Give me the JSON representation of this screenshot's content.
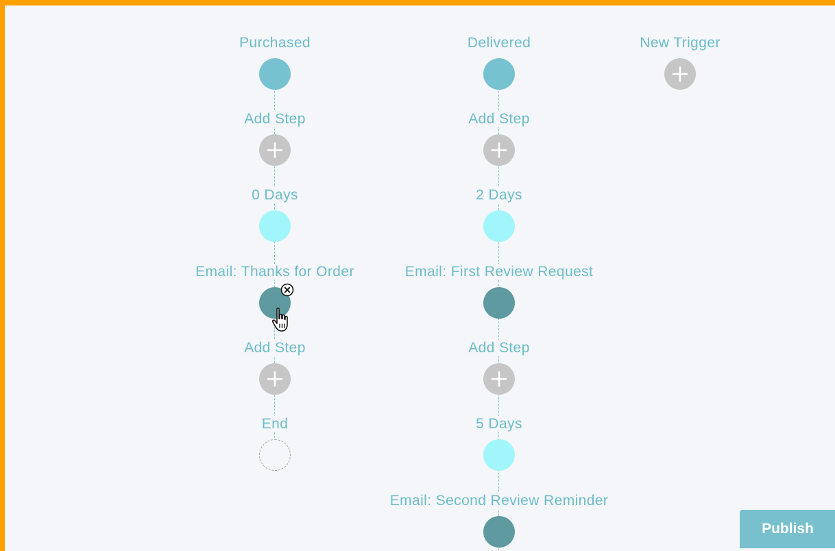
{
  "colors": {
    "frame": "#ff9f00",
    "canvas": "#f4f6f9",
    "label": "#6bbcc9",
    "trigger_node": "#76c2d0",
    "delay_node": "#a0f6fa",
    "email_node": "#5e9aa0",
    "add_node": "#c6c6c6",
    "publish_button": "#78c0cd"
  },
  "flow1": {
    "trigger": "Purchased",
    "add_step_1": "Add Step",
    "delay_1": "0 Days",
    "email_1": "Email: Thanks for Order",
    "add_step_2": "Add Step",
    "end": "End"
  },
  "flow2": {
    "trigger": "Delivered",
    "add_step_1": "Add Step",
    "delay_1": "2 Days",
    "email_1": "Email: First Review Request",
    "add_step_2": "Add Step",
    "delay_2": "5 Days",
    "email_2": "Email: Second Review Reminder"
  },
  "new_trigger": {
    "label": "New Trigger",
    "icon": "plus-icon"
  },
  "toolbar": {
    "publish_label": "Publish"
  }
}
